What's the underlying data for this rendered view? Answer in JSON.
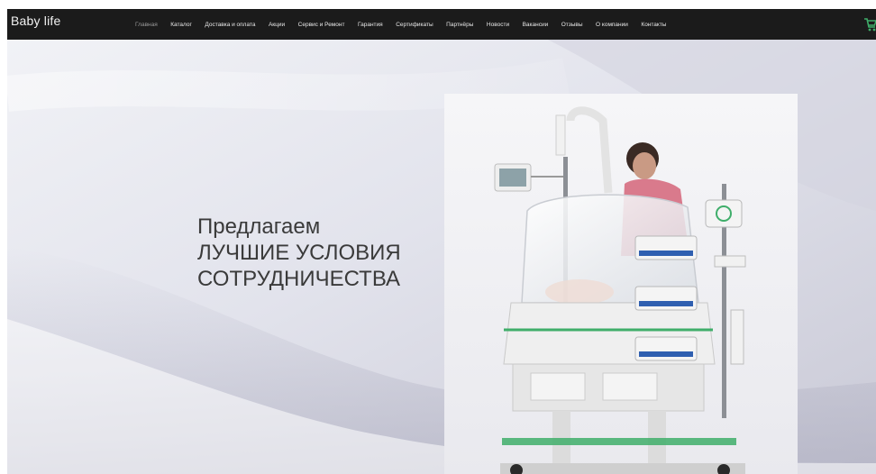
{
  "header": {
    "logo": "Baby life",
    "nav": [
      {
        "label": "Главная",
        "active": true
      },
      {
        "label": "Каталог",
        "active": false
      },
      {
        "label": "Доставка и оплата",
        "active": false
      },
      {
        "label": "Акции",
        "active": false
      },
      {
        "label": "Сервис и Ремонт",
        "active": false
      },
      {
        "label": "Гарантия",
        "active": false
      },
      {
        "label": "Сертификаты",
        "active": false
      },
      {
        "label": "Партнёры",
        "active": false
      },
      {
        "label": "Новости",
        "active": false
      },
      {
        "label": "Вакансии",
        "active": false
      },
      {
        "label": "Отзывы",
        "active": false
      },
      {
        "label": "О компании",
        "active": false
      },
      {
        "label": "Контакты",
        "active": false
      }
    ],
    "cart_icon": "cart-icon"
  },
  "hero": {
    "line1": "Предлагаем",
    "line2": "ЛУЧШИЕ УСЛОВИЯ",
    "line3": "СОТРУДНИЧЕСТВА"
  },
  "colors": {
    "header_bg": "#1b1b1b",
    "accent_green": "#3fae6a",
    "hero_text": "#3a3a3a"
  }
}
